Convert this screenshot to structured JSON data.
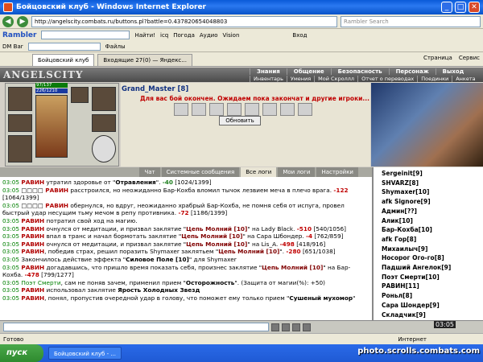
{
  "window": {
    "title": "Бойцовский клуб - Windows Internet Explorer",
    "min": "_",
    "max": "□",
    "close": "✕"
  },
  "address": {
    "url": "http://angelscity.combats.ru/buttons.pl?battle=0.437820654048803",
    "search_placeholder": "Rambler Search"
  },
  "toolbar1": {
    "brand": "Rambler",
    "find": "Найти!",
    "icq": "icq",
    "weather": "Погода",
    "audio": "Аудио",
    "vision": "Vision",
    "login": "Вход"
  },
  "toolbar2": {
    "dmbar": "DM Bar",
    "files": "Файлы"
  },
  "tabs": [
    {
      "label": "Бойцовский клуб"
    },
    {
      "label": "Входящие 27(0) — Яндекс..."
    }
  ],
  "tabtools": {
    "page": "Страница",
    "service": "Сервис"
  },
  "game": {
    "logo": "ANGELSCITY",
    "menu_top": [
      "Знания",
      "Общение",
      "Безопасность",
      "Персонаж",
      "Выход"
    ],
    "menu_sub": [
      "Инвентарь",
      "Умения",
      "Мой Скроллл",
      "Отчет о переводах",
      "Поединки",
      "Анкета"
    ],
    "hp": "97/137",
    "mp": "226/1210",
    "player": "Grand_Master [8]",
    "wait_msg": "Для вас бой окончен. Ожидаем пока закончат и другие игроки...",
    "refresh": "Обновить"
  },
  "chat_tabs": [
    "Чат",
    "Системные сообщения",
    "Все логи",
    "Мои логи",
    "Настройки"
  ],
  "log": [
    [
      {
        "c": "t",
        "v": "03:05 "
      },
      {
        "c": "nm",
        "v": "РАВИН"
      },
      {
        "v": " утратил здоровье от \""
      },
      {
        "c": "b",
        "v": "Отравления"
      },
      {
        "v": "\". "
      },
      {
        "c": "gn",
        "v": "-40"
      },
      {
        "v": " [1024/1399]"
      }
    ],
    [
      {
        "c": "t",
        "v": "03:05 "
      },
      {
        "v": "□□□□ "
      },
      {
        "c": "nm",
        "v": "РАВИН"
      },
      {
        "v": " расстроился, но неожиданно Бар-Кохба вломил тычок лезвием меча в плечо врага. "
      },
      {
        "c": "dmg",
        "v": "-122"
      },
      {
        "v": " [1064/1399]"
      }
    ],
    [
      {
        "c": "t",
        "v": "03:05 "
      },
      {
        "v": "□□□□ "
      },
      {
        "c": "nm",
        "v": "РАВИН"
      },
      {
        "v": " обернулся, но вдруг, неожиданно храбрый Бар-Кохба, не помня себя от испуга, провел быстрый удар несущим тьму мечом в репу противника. "
      },
      {
        "c": "dmg",
        "v": "-72"
      },
      {
        "v": " [1186/1399]"
      }
    ],
    [
      {
        "c": "t",
        "v": "03:05 "
      },
      {
        "c": "nm",
        "v": "РАВИН"
      },
      {
        "v": " потратил свой ход на магию."
      }
    ],
    [
      {
        "c": "t",
        "v": "03:05 "
      },
      {
        "c": "nm",
        "v": "РАВИН"
      },
      {
        "v": " очнулся от медитации, и призвал заклятие \""
      },
      {
        "c": "sp",
        "v": "Цепь Молний [10]"
      },
      {
        "v": "\" на Lady Black. "
      },
      {
        "c": "dmg",
        "v": "-510"
      },
      {
        "v": " [540/1056]"
      }
    ],
    [
      {
        "c": "t",
        "v": "03:05 "
      },
      {
        "c": "nm",
        "v": "РАВИН"
      },
      {
        "v": " впал в транс и начал бормотать заклятие \""
      },
      {
        "c": "sp",
        "v": "Цепь Молний [10]"
      },
      {
        "v": "\" на Сара Шбондер. "
      },
      {
        "c": "dmg",
        "v": "-4"
      },
      {
        "v": " [762/859]"
      }
    ],
    [
      {
        "c": "t",
        "v": "03:05 "
      },
      {
        "c": "nm",
        "v": "РАВИН"
      },
      {
        "v": " очнулся от медитации, и призвал заклятие \""
      },
      {
        "c": "sp",
        "v": "Цепь Молний [10]"
      },
      {
        "v": "\" на Lis_A. "
      },
      {
        "c": "dmg",
        "v": "-498"
      },
      {
        "v": " [418/916]"
      }
    ],
    [
      {
        "c": "t",
        "v": "03:05 "
      },
      {
        "c": "nm",
        "v": "РАВИН"
      },
      {
        "v": ", победив страх, решил поразить Shymaxer заклятьем \""
      },
      {
        "c": "sp",
        "v": "Цепь Молний [10]"
      },
      {
        "v": "\". "
      },
      {
        "c": "dmg",
        "v": "-280"
      },
      {
        "v": " [651/1038]"
      }
    ],
    [
      {
        "c": "t",
        "v": "03:05 "
      },
      {
        "v": "Закончилось действие эффекта \""
      },
      {
        "c": "b",
        "v": "Силовое Поле [10]"
      },
      {
        "v": "\" для Shymaxer"
      }
    ],
    [
      {
        "c": "t",
        "v": "03:05 "
      },
      {
        "c": "nm",
        "v": "РАВИН"
      },
      {
        "v": " догадавшись, что пришло время показать себя, произнес заклятие \""
      },
      {
        "c": "sp",
        "v": "Цепь Молний [10]"
      },
      {
        "v": "\" на Бар-Кохба. "
      },
      {
        "c": "dmg",
        "v": "-478"
      },
      {
        "v": " [799/1277]"
      }
    ],
    [
      {
        "c": "t",
        "v": "03:05 "
      },
      {
        "c": "t",
        "v": "Поэт Смерти"
      },
      {
        "v": ", сам не поняв зачем, применил прием \""
      },
      {
        "c": "b",
        "v": "Осторожность"
      },
      {
        "v": "\". (Защита от магии(%): +50)"
      }
    ],
    [
      {
        "c": "t",
        "v": "03:05 "
      },
      {
        "c": "nm",
        "v": "РАВИН"
      },
      {
        "v": " использовал заклятие "
      },
      {
        "c": "b",
        "v": "Ярость Холодных Звезд"
      }
    ],
    [
      {
        "c": "t",
        "v": "03:05 "
      },
      {
        "c": "nm",
        "v": "РАВИН"
      },
      {
        "v": ", понял, пропустив очередной удар в голову, что поможет ему только прием \""
      },
      {
        "c": "b",
        "v": "Сушеный мухомор"
      },
      {
        "v": "\""
      }
    ]
  ],
  "roster": [
    {
      "pre": "",
      "name": "Sergeinit",
      "lvl": "[9]",
      "bad": false
    },
    {
      "pre": "",
      "name": "SHVARZ",
      "lvl": "[8]",
      "bad": false
    },
    {
      "pre": "",
      "name": "Shymaxer",
      "lvl": "[10]",
      "bad": false
    },
    {
      "pre": "afk ",
      "name": "Signore",
      "lvl": "[9]",
      "bad": false
    },
    {
      "pre": "",
      "name": "Админ",
      "lvl": "[??]",
      "bad": false
    },
    {
      "pre": "",
      "name": "Алик",
      "lvl": "[10]",
      "bad": false
    },
    {
      "pre": "",
      "name": "Бар-Кохба",
      "lvl": "[10]",
      "bad": false
    },
    {
      "pre": "afk ",
      "name": "Гор",
      "lvl": "[8]",
      "bad": false
    },
    {
      "pre": "",
      "name": "Михаилыч",
      "lvl": "[9]",
      "bad": false
    },
    {
      "pre": "",
      "name": "Носорог Ого-го",
      "lvl": "[8]",
      "bad": false
    },
    {
      "pre": "",
      "name": "Падший Ангелок",
      "lvl": "[9]",
      "bad": false
    },
    {
      "pre": "",
      "name": "Поэт Смерти",
      "lvl": "[10]",
      "bad": false
    },
    {
      "pre": "",
      "name": "РАВИН",
      "lvl": "[11]",
      "bad": false
    },
    {
      "pre": "",
      "name": "Роньл",
      "lvl": "[8]",
      "bad": false
    },
    {
      "pre": "",
      "name": "Сара Шондер",
      "lvl": "[9]",
      "bad": false
    },
    {
      "pre": "",
      "name": "Складчик",
      "lvl": "[9]",
      "bad": false
    }
  ],
  "clock": "03:05",
  "status": {
    "left": "Готово",
    "zone": "Интернет"
  },
  "taskbar": {
    "start": "пуск",
    "task1": "Бойцовский клуб - ..."
  },
  "watermark": "photo.scrolls.combats.com"
}
